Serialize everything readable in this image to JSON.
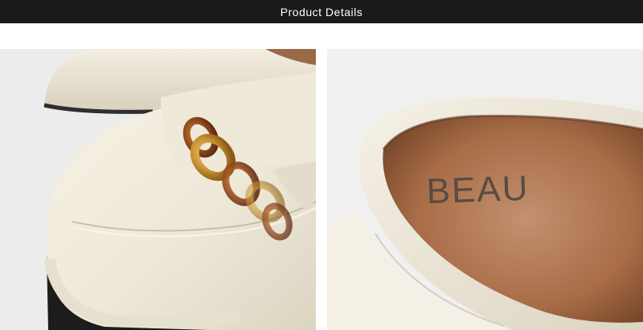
{
  "header": {
    "title": "Product Details"
  },
  "photos": [
    {
      "name": "loafer-chain-detail"
    },
    {
      "name": "loafer-insole-detail",
      "insole_brand_text": "BEAU"
    }
  ],
  "colors": {
    "header_bg": "#1a1a1a",
    "header_text": "#ffffff",
    "leather": "#efeadc",
    "chain_gold": "#c99a35",
    "chain_amber": "#8b4a22",
    "insole": "#a86d47"
  }
}
